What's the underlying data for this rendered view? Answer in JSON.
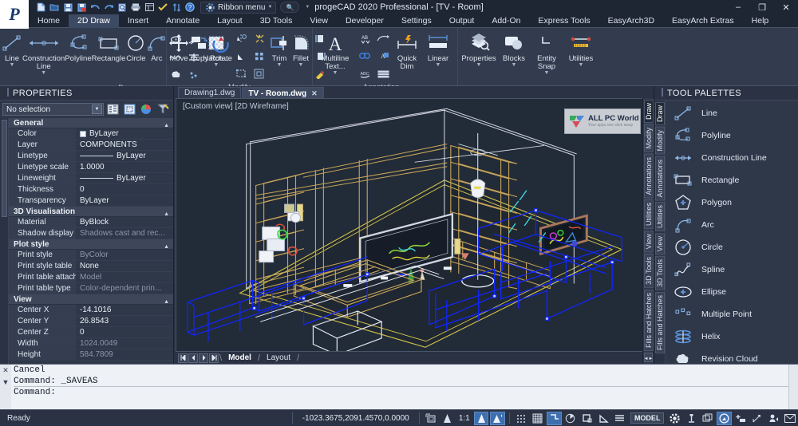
{
  "window": {
    "title": "progeCAD 2020 Professional - [TV - Room]",
    "minimize": "–",
    "maximize": "❐",
    "close": "✕"
  },
  "quick_access": {
    "ribbon_menu_label": "Ribbon menu",
    "items": [
      {
        "name": "new-icon",
        "glyph": "🗋"
      },
      {
        "name": "open-icon",
        "glyph": "🗀"
      },
      {
        "name": "save-icon",
        "glyph": "🖫"
      },
      {
        "name": "save-as-icon",
        "glyph": "🖬"
      },
      {
        "name": "undo-icon",
        "glyph": "↩"
      },
      {
        "name": "redo-icon",
        "glyph": "↪"
      },
      {
        "name": "print-preview-icon",
        "glyph": "🔍"
      },
      {
        "name": "print-icon",
        "glyph": "🖨"
      },
      {
        "name": "layout-icon",
        "glyph": "▤"
      },
      {
        "name": "check-icon",
        "glyph": "✔"
      },
      {
        "name": "sync-icon",
        "glyph": "⇅"
      },
      {
        "name": "help-icon",
        "glyph": "?"
      },
      {
        "name": "gear-icon",
        "glyph": "⚙"
      }
    ]
  },
  "ribbon_tabs": [
    {
      "label": "Home",
      "active": false
    },
    {
      "label": "2D Draw",
      "active": true
    },
    {
      "label": "Insert",
      "active": false
    },
    {
      "label": "Annotate",
      "active": false
    },
    {
      "label": "Layout",
      "active": false
    },
    {
      "label": "3D Tools",
      "active": false
    },
    {
      "label": "View",
      "active": false
    },
    {
      "label": "Developer",
      "active": false
    },
    {
      "label": "Settings",
      "active": false
    },
    {
      "label": "Output",
      "active": false
    },
    {
      "label": "Add-On",
      "active": false
    },
    {
      "label": "Express Tools",
      "active": false
    },
    {
      "label": "EasyArch3D",
      "active": false
    },
    {
      "label": "EasyArch Extras",
      "active": false
    },
    {
      "label": "Help",
      "active": false
    }
  ],
  "ribbon_panels": [
    {
      "title": "Draw",
      "buttons": [
        {
          "label": "Line",
          "icon": "line-icon",
          "dropdown": true
        },
        {
          "label": "Construction Line",
          "icon": "construction-line-icon",
          "dropdown": true
        },
        {
          "label": "Polyline",
          "icon": "polyline-icon",
          "dropdown": false
        },
        {
          "label": "Rectangle",
          "icon": "rectangle-icon",
          "dropdown": false
        },
        {
          "label": "Circle",
          "icon": "circle-icon",
          "dropdown": false
        },
        {
          "label": "Arc",
          "icon": "arc-icon",
          "dropdown": false
        },
        {
          "label": "Hatch...",
          "icon": "hatch-icon",
          "dropdown": true
        }
      ],
      "small_icons": [
        "ellipse-icon",
        "spline-icon",
        "revision-cloud-icon",
        "multiline-icon",
        "gradient-icon",
        "point-icon"
      ]
    },
    {
      "title": "Modify",
      "buttons": [
        {
          "label": "Move",
          "icon": "move-icon",
          "dropdown": false
        },
        {
          "label": "Copy",
          "icon": "copy-icon",
          "dropdown": false
        },
        {
          "label": "Rotate",
          "icon": "rotate-icon",
          "dropdown": false
        },
        {
          "label": "Trim",
          "icon": "trim-icon",
          "dropdown": true
        },
        {
          "label": "Fillet",
          "icon": "fillet-icon",
          "dropdown": true
        }
      ],
      "small_icons": [
        "mirror-icon",
        "scale-icon",
        "stretch-icon",
        "explode-icon",
        "array-icon",
        "offset-icon"
      ]
    },
    {
      "title": "Annotation",
      "buttons": [
        {
          "label": "Multiline Text...",
          "icon": "multiline-text-icon",
          "dropdown": true
        },
        {
          "label": "Quick Dim",
          "icon": "quick-dim-icon",
          "dropdown": false
        },
        {
          "label": "Linear",
          "icon": "linear-dim-icon",
          "dropdown": true
        }
      ],
      "small_icons": [
        "text-style-icon",
        "leader-icon",
        "find-icon",
        "scale-text-icon",
        "spell-check-icon",
        "table-icon"
      ]
    },
    {
      "title": "",
      "buttons": [
        {
          "label": "Properties",
          "icon": "properties-icon",
          "dropdown": true
        },
        {
          "label": "Blocks",
          "icon": "blocks-icon",
          "dropdown": true
        },
        {
          "label": "Entity Snap",
          "icon": "entity-snap-icon",
          "dropdown": true
        },
        {
          "label": "Utilities",
          "icon": "utilities-icon",
          "dropdown": true
        }
      ],
      "small_icons": []
    }
  ],
  "properties": {
    "title": "PROPERTIES",
    "selection": "No selection",
    "toolbar_icons": [
      "quick-select-icon",
      "select-all-icon",
      "pick-add-icon",
      "filter-icon"
    ],
    "groups": [
      {
        "name": "General",
        "rows": [
          {
            "key": "Color",
            "value": "ByLayer",
            "swatch": true,
            "dim": false
          },
          {
            "key": "Layer",
            "value": "COMPONENTS",
            "dim": false
          },
          {
            "key": "Linetype",
            "value": "ByLayer",
            "linetype": true,
            "dim": false
          },
          {
            "key": "Linetype scale",
            "value": "1.0000",
            "dim": false
          },
          {
            "key": "Lineweight",
            "value": "ByLayer",
            "linetype": true,
            "dim": false
          },
          {
            "key": "Thickness",
            "value": "0",
            "dim": false
          },
          {
            "key": "Transparency",
            "value": "ByLayer",
            "dim": false
          }
        ]
      },
      {
        "name": "3D Visualisation",
        "rows": [
          {
            "key": "Material",
            "value": "ByBlock",
            "dim": false
          },
          {
            "key": "Shadow display",
            "value": "Shadows cast and rec...",
            "dim": true
          }
        ]
      },
      {
        "name": "Plot style",
        "rows": [
          {
            "key": "Print style",
            "value": "ByColor",
            "dim": true
          },
          {
            "key": "Print style table",
            "value": "None",
            "dim": false
          },
          {
            "key": "Print table attached to",
            "value": "Model",
            "dim": true
          },
          {
            "key": "Print table type",
            "value": "Color-dependent prin...",
            "dim": true
          }
        ]
      },
      {
        "name": "View",
        "rows": [
          {
            "key": "Center X",
            "value": "-14.1016",
            "dim": false
          },
          {
            "key": "Center Y",
            "value": "26.8543",
            "dim": false
          },
          {
            "key": "Center Z",
            "value": "0",
            "dim": false
          },
          {
            "key": "Width",
            "value": "1024.0049",
            "dim": true
          },
          {
            "key": "Height",
            "value": "584.7809",
            "dim": true
          }
        ]
      }
    ]
  },
  "document_tabs": [
    {
      "label": "Drawing1.dwg",
      "active": false,
      "closable": false
    },
    {
      "label": "TV - Room.dwg",
      "active": true,
      "closable": true,
      "close_glyph": "✕"
    }
  ],
  "viewport": {
    "label": "[Custom view] [2D Wireframe]",
    "watermark_title": "ALL PC World",
    "watermark_subtitle": "Your apps one click away"
  },
  "model_bar": {
    "nav_buttons": [
      "◀◀",
      "◀",
      "▶",
      "▶▶"
    ],
    "tabs": [
      {
        "label": "Model",
        "active": true
      },
      {
        "label": "Layout",
        "active": false
      }
    ]
  },
  "vertical_dock": [
    {
      "label": "Draw",
      "active": true
    },
    {
      "label": "Modify",
      "active": false
    },
    {
      "label": "Annotations",
      "active": false
    },
    {
      "label": "Utilities",
      "active": false
    },
    {
      "label": "View",
      "active": false
    },
    {
      "label": "3D Tools",
      "active": false
    },
    {
      "label": "Fills and Hatches",
      "active": false
    }
  ],
  "tool_palettes": {
    "title": "TOOL PALETTES",
    "tabs": [
      {
        "label": "Draw",
        "active": true
      },
      {
        "label": "Modify",
        "active": false
      },
      {
        "label": "Annotations",
        "active": false
      },
      {
        "label": "Utilities",
        "active": false
      },
      {
        "label": "View",
        "active": false
      },
      {
        "label": "3D Tools",
        "active": false
      },
      {
        "label": "Fills and Hatches",
        "active": false
      }
    ],
    "items": [
      {
        "label": "Line",
        "icon": "line-icon"
      },
      {
        "label": "Polyline",
        "icon": "polyline-icon"
      },
      {
        "label": "Construction Line",
        "icon": "construction-line-icon"
      },
      {
        "label": "Rectangle",
        "icon": "rectangle-icon"
      },
      {
        "label": "Polygon",
        "icon": "polygon-icon"
      },
      {
        "label": "Arc",
        "icon": "arc-icon"
      },
      {
        "label": "Circle",
        "icon": "circle-icon"
      },
      {
        "label": "Spline",
        "icon": "spline-icon"
      },
      {
        "label": "Ellipse",
        "icon": "ellipse-icon"
      },
      {
        "label": "Multiple Point",
        "icon": "multiple-point-icon"
      },
      {
        "label": "Helix",
        "icon": "helix-icon"
      },
      {
        "label": "Revision Cloud",
        "icon": "revision-cloud-icon"
      }
    ]
  },
  "command_line": {
    "history_line1": "Cancel",
    "history_line2": "Command:  _SAVEAS",
    "prompt": "Command:",
    "close_glyph": "✕",
    "expand_glyph": "▼"
  },
  "status_bar": {
    "ready": "Ready",
    "coordinates": "-1023.3675,2091.4570,0.0000",
    "scale": "1:1",
    "model_label": "MODEL",
    "icons": [
      {
        "name": "viewport-icon",
        "glyph": "▣",
        "on": false
      },
      {
        "name": "annotation-scale-icon",
        "glyph": "🅰",
        "on": false
      },
      {
        "name": "annotation-visibility-icon",
        "glyph": "🅰",
        "on": true
      },
      {
        "name": "annotation-auto-icon",
        "glyph": "🅰",
        "on": true
      },
      {
        "name": "snap-icon",
        "glyph": "⣿",
        "on": false
      },
      {
        "name": "grid-icon",
        "glyph": "▦",
        "on": false
      },
      {
        "name": "ortho-icon",
        "glyph": "⌐",
        "on": true
      },
      {
        "name": "polar-icon",
        "glyph": "◔",
        "on": false
      },
      {
        "name": "esnap-icon",
        "glyph": "⊡",
        "on": false
      },
      {
        "name": "otrack-icon",
        "glyph": "◺",
        "on": false
      },
      {
        "name": "lineweight-icon",
        "glyph": "≡",
        "on": false
      },
      {
        "name": "settings-gear-icon",
        "glyph": "⚙",
        "on": false
      },
      {
        "name": "ucs-icon",
        "glyph": "⊥",
        "on": false
      },
      {
        "name": "workspace-icon",
        "glyph": "❏",
        "on": false
      },
      {
        "name": "clean-screen-icon",
        "glyph": "🧭",
        "on": true
      },
      {
        "name": "add-tool-icon",
        "glyph": "➕",
        "on": false
      },
      {
        "name": "dyn-input-icon",
        "glyph": "↗",
        "on": false
      },
      {
        "name": "user-icon",
        "glyph": "👤",
        "on": false
      },
      {
        "name": "mail-icon",
        "glyph": "✉",
        "on": false
      }
    ]
  },
  "colors": {
    "accent": "#3e6fae",
    "chrome_dark": "#2a3243",
    "chrome_mid": "#333c4e",
    "canvas": "#222b38",
    "icon_blue": "#5b8fd4",
    "furniture_tan": "#c8a558",
    "selection_blue": "#1026ff",
    "floor_yellow": "#cfc04a"
  }
}
